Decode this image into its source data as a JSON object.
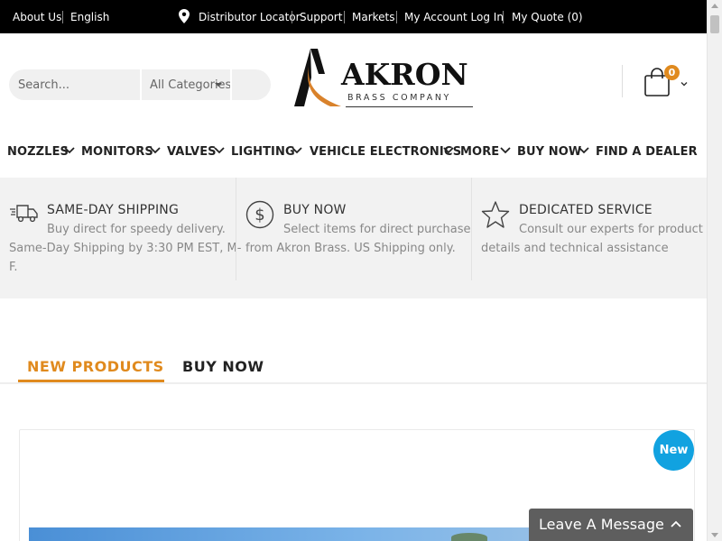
{
  "topbar": {
    "about": "About Us",
    "language": "English",
    "distributor": "Distributor Locator",
    "support": "Support",
    "markets": "Markets",
    "account": "My Account Log In",
    "quote": "My Quote (0)"
  },
  "search": {
    "placeholder": "Search...",
    "category": "All Categories"
  },
  "logo": {
    "word": "AKRON",
    "sub": "BRASS COMPANY"
  },
  "cart": {
    "count": "0"
  },
  "nav": [
    "NOZZLES",
    "MONITORS",
    "VALVES",
    "LIGHTING",
    "VEHICLE ELECTRONICS",
    "MORE",
    "BUY NOW",
    "FIND A DEALER"
  ],
  "features": [
    {
      "icon": "truck-icon",
      "title": "SAME-DAY SHIPPING",
      "line1": "Buy direct for speedy delivery.",
      "line2": "Same-Day Shipping by 3:30 PM EST, M-",
      "line3": "F."
    },
    {
      "icon": "dollar-icon",
      "title": "BUY NOW",
      "line1": "Select items for direct purchase",
      "line2": "from Akron Brass. US Shipping only.",
      "line3": ""
    },
    {
      "icon": "star-icon",
      "title": "DEDICATED SERVICE",
      "line1": "Consult our experts for product",
      "line2": "details and technical assistance",
      "line3": ""
    }
  ],
  "tabs": {
    "active": "NEW PRODUCTS",
    "inactive": "BUY NOW"
  },
  "product": {
    "badge": "New"
  },
  "chat": {
    "label": "Leave A Message"
  },
  "colors": {
    "accent": "#e08a1e",
    "badge": "#11a2e0",
    "topbar": "#000000"
  }
}
